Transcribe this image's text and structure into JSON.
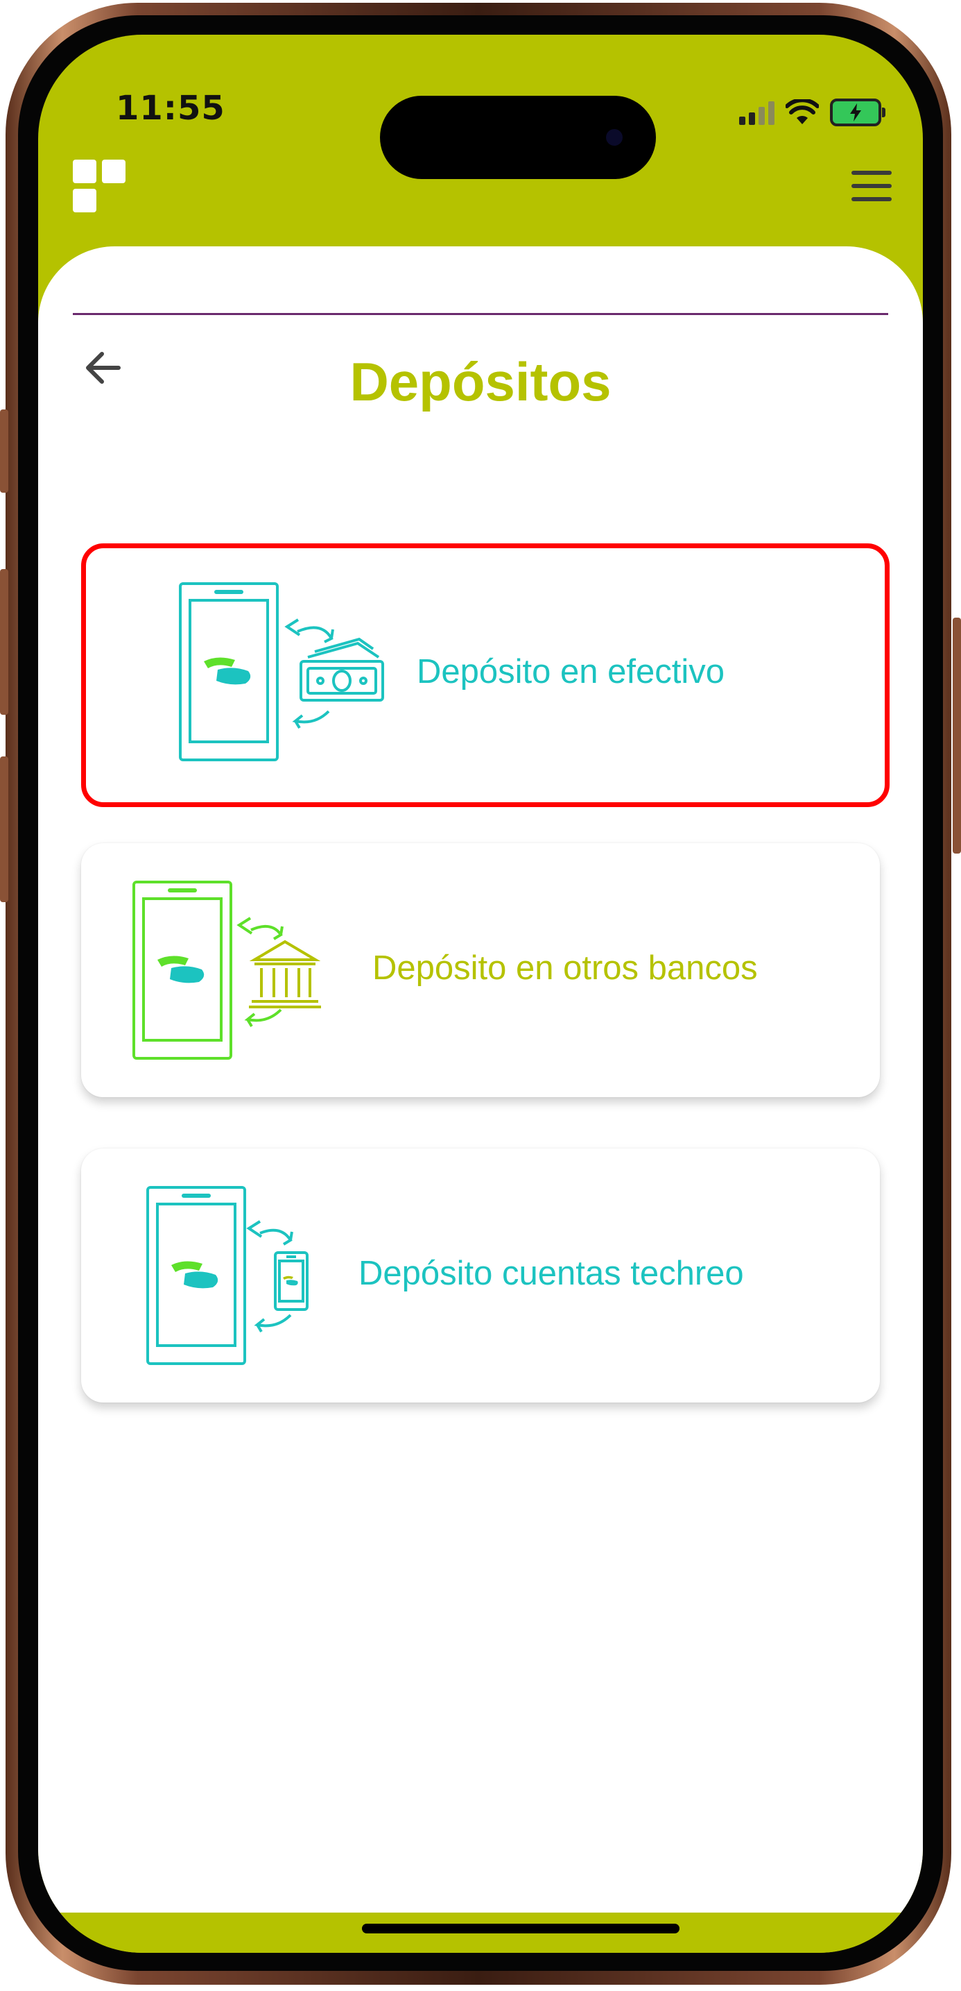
{
  "status_bar": {
    "time": "11:55",
    "icons": [
      "cellular-signal-icon",
      "wifi-icon",
      "battery-charging-icon"
    ]
  },
  "header": {
    "logo_icon": "app-logo-icon",
    "menu_icon": "hamburger-menu-icon"
  },
  "page": {
    "title": "Depósitos",
    "back_icon": "arrow-left-icon"
  },
  "options": [
    {
      "label": "Depósito en efectivo",
      "icon": "phone-cash-deposit-icon",
      "color": "#1cc3c0",
      "selected": true
    },
    {
      "label": "Depósito en otros bancos",
      "icon": "phone-bank-deposit-icon",
      "color": "#b5c200",
      "selected": false
    },
    {
      "label": "Depósito cuentas techreo",
      "icon": "phone-to-phone-deposit-icon",
      "color": "#1cc3c0",
      "selected": false
    }
  ],
  "colors": {
    "brand_lime": "#b5c200",
    "teal": "#1cc3c0",
    "green": "#5ee02a",
    "divider": "#6b2a6e",
    "highlight": "#ff0000"
  }
}
